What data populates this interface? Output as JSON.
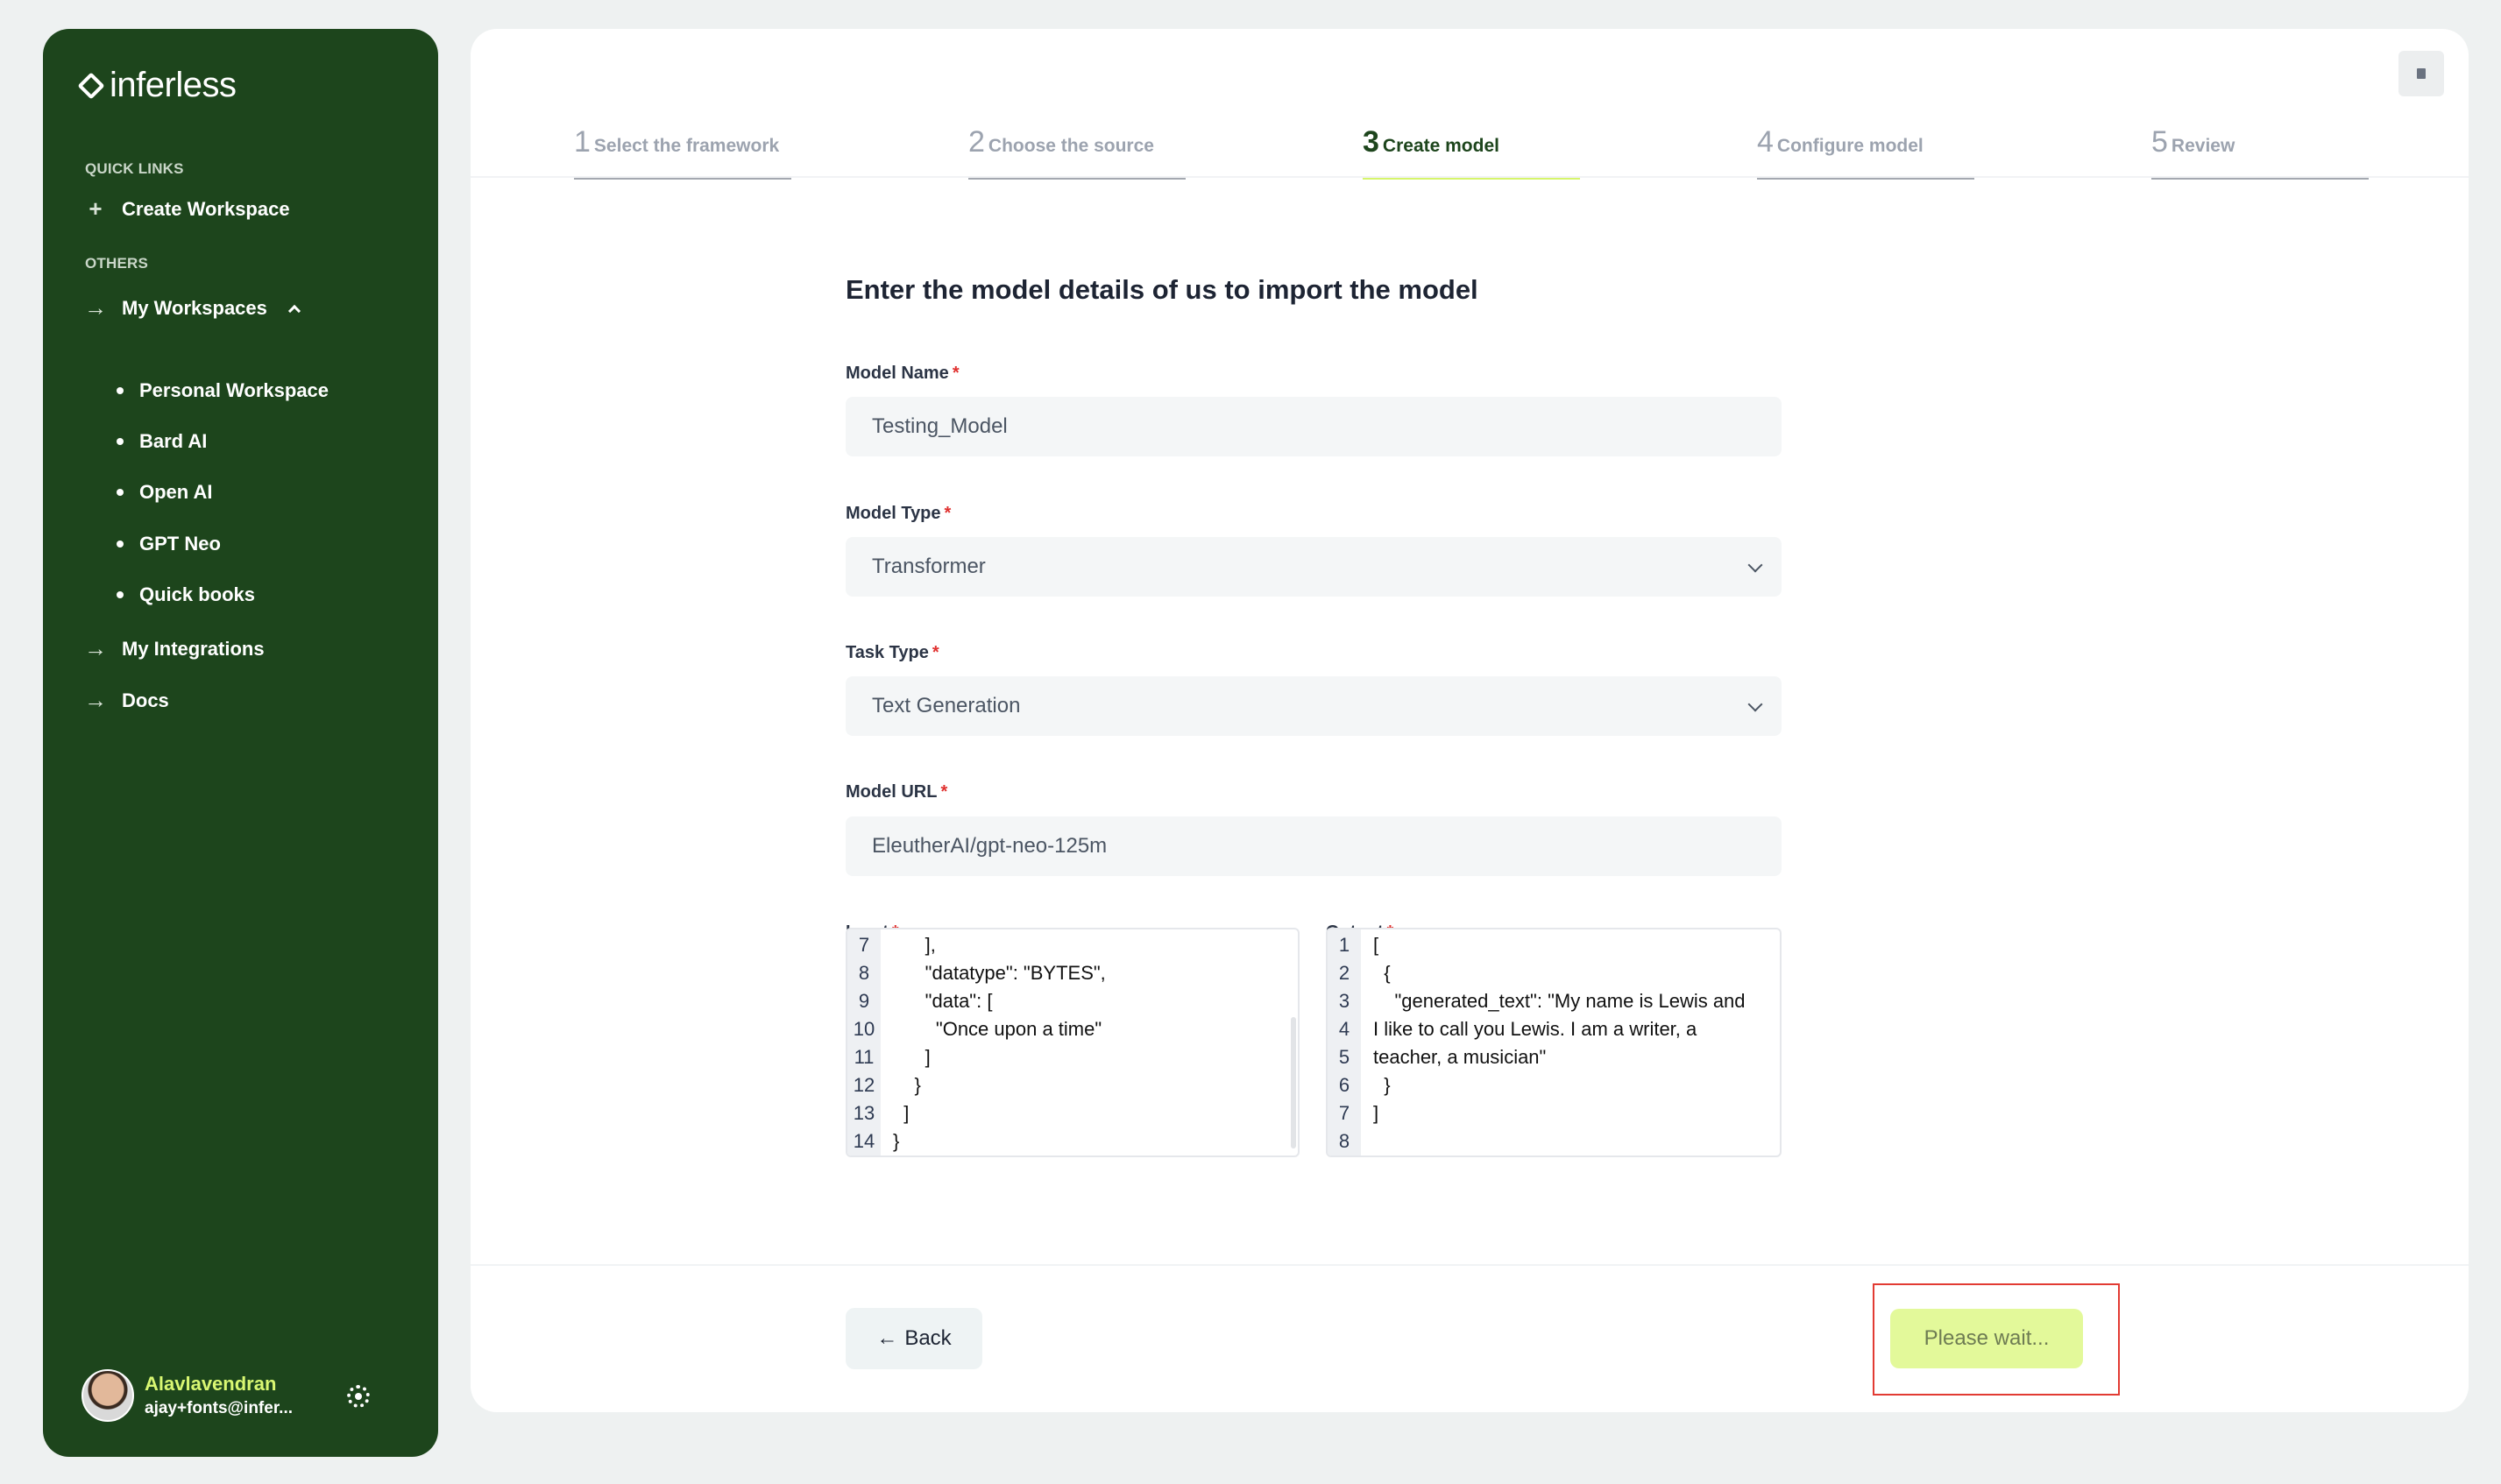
{
  "brand": {
    "name": "inferless"
  },
  "sidebar": {
    "quick_links_heading": "QUICK LINKS",
    "create_workspace": "Create Workspace",
    "others_heading": "OTHERS",
    "my_workspaces": "My Workspaces",
    "workspaces": [
      "Personal Workspace",
      "Bard AI",
      "Open AI",
      "GPT Neo",
      "Quick books"
    ],
    "my_integrations": "My Integrations",
    "docs": "Docs",
    "user": {
      "name": "Alavlavendran",
      "email": "ajay+fonts@infer..."
    }
  },
  "steps": [
    {
      "num": "1",
      "label": "Select the framework"
    },
    {
      "num": "2",
      "label": "Choose the source"
    },
    {
      "num": "3",
      "label": "Create model"
    },
    {
      "num": "4",
      "label": "Configure model"
    },
    {
      "num": "5",
      "label": "Review"
    }
  ],
  "active_step": 3,
  "form": {
    "title": "Enter the model details of us to import the model",
    "model_name": {
      "label": "Model Name",
      "value": "Testing_Model"
    },
    "model_type": {
      "label": "Model Type",
      "value": "Transformer"
    },
    "task_type": {
      "label": "Task Type",
      "value": "Text Generation"
    },
    "model_url": {
      "label": "Model URL",
      "value": "EleutherAI/gpt-neo-125m"
    },
    "required_mark": "*",
    "input": {
      "label": "Input",
      "lines": [
        {
          "n": "7",
          "text": "      ],"
        },
        {
          "n": "8",
          "text": "      \"datatype\": \"BYTES\","
        },
        {
          "n": "9",
          "text": "      \"data\": ["
        },
        {
          "n": "10",
          "text": "        \"Once upon a time\""
        },
        {
          "n": "11",
          "text": "      ]"
        },
        {
          "n": "12",
          "text": "    }"
        },
        {
          "n": "13",
          "text": "  ]"
        },
        {
          "n": "14",
          "text": "}"
        }
      ]
    },
    "output": {
      "label": "Output",
      "lines": [
        {
          "n": "1",
          "text": "["
        },
        {
          "n": "2",
          "text": "  {"
        },
        {
          "n": "3",
          "text": "    \"generated_text\": \"My name is Lewis and"
        },
        {
          "n": "4",
          "text": "I like to call you Lewis. I am a writer, a"
        },
        {
          "n": "5",
          "text": "teacher, a musician\""
        },
        {
          "n": "6",
          "text": "  }"
        },
        {
          "n": "7",
          "text": "]"
        },
        {
          "n": "8",
          "text": ""
        }
      ]
    }
  },
  "buttons": {
    "back": "Back",
    "wait": "Please wait..."
  },
  "colors": {
    "sidebar_bg": "#1d451c",
    "accent": "#d6f56b",
    "user_name": "#d9f772",
    "highlight_frame": "#e23b33"
  }
}
